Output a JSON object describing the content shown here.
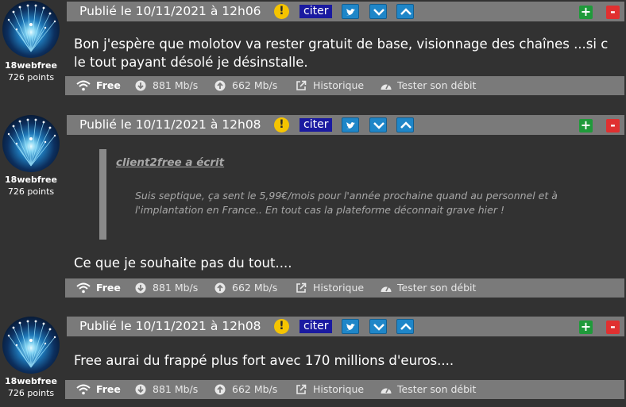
{
  "posts": [
    {
      "author": {
        "name": "18webfree",
        "points": "726 points"
      },
      "date": "Publié le 10/11/2021 à 12h06",
      "cite_label": "citer",
      "plus_label": "+",
      "minus_label": "-",
      "warn_label": "!",
      "body": "Bon j'espère que molotov va rester gratuit de base, visionnage des chaînes ...si c le tout payant désolé je désinstalle.",
      "quote": null,
      "footer": {
        "isp": "Free",
        "down": "881 Mb/s",
        "up": "662 Mb/s",
        "history": "Historique",
        "test": "Tester son débit"
      }
    },
    {
      "author": {
        "name": "18webfree",
        "points": "726 points"
      },
      "date": "Publié le 10/11/2021 à 12h08",
      "cite_label": "citer",
      "plus_label": "+",
      "minus_label": "-",
      "warn_label": "!",
      "quote": {
        "author": "client2free a écrit",
        "text": "Suis septique, ça sent le 5,99€/mois pour l'année prochaine quand au personnel et à l'implantation en France.. En tout cas la plateforme déconnait grave hier !"
      },
      "body": "Ce que je souhaite pas du tout....",
      "footer": {
        "isp": "Free",
        "down": "881 Mb/s",
        "up": "662 Mb/s",
        "history": "Historique",
        "test": "Tester son débit"
      }
    },
    {
      "author": {
        "name": "18webfree",
        "points": "726 points"
      },
      "date": "Publié le 10/11/2021 à 12h08",
      "cite_label": "citer",
      "plus_label": "+",
      "minus_label": "-",
      "warn_label": "!",
      "body": "Free aurai du frappé plus fort avec 170 millions d'euros....",
      "quote": null,
      "footer": {
        "isp": "Free",
        "down": "881 Mb/s",
        "up": "662 Mb/s",
        "history": "Historique",
        "test": "Tester son débit"
      }
    }
  ],
  "colors": {
    "background": "#323232",
    "header": "#7a7a7a",
    "cite": "#1a1aa0",
    "twitter": "#1f86c8",
    "plus": "#1f9a3a",
    "minus": "#e03030",
    "warn": "#f5c400"
  }
}
